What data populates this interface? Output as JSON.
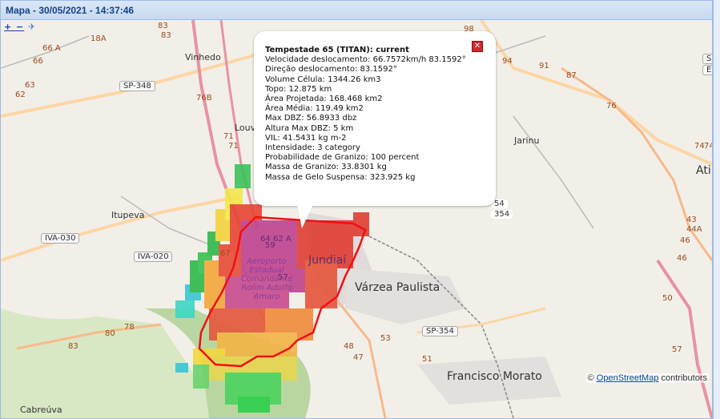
{
  "window": {
    "title": "Mapa - 30/05/2021 - 14:37:46"
  },
  "controls": {
    "zoom": "+ −",
    "layer_icon": "airplane-icon"
  },
  "popup": {
    "title": "Tempestade 65 (TITAN): current",
    "lines": [
      "Velocidade deslocamento: 66.7572km/h 83.1592°",
      "Direção deslocamento: 83.1592°",
      "Volume Célula: 1344.26 km3",
      "Topo: 12.875 km",
      "Área Projetada: 168.468 km2",
      "Área Média: 119.49 km2",
      "Max DBZ: 56.8933 dbz",
      "Altura Max DBZ: 5 km",
      "VIL: 41.5431 kg m-2",
      "Intensidade: 3 category",
      "Probabilidade de Granizo: 100 percent",
      "Massa de Granizo: 33.8301 kg",
      "Massa de Gelo Suspensa: 323.925 kg"
    ],
    "close_icon": "close-icon"
  },
  "attribution": {
    "prefix": "©",
    "link": "OpenStreetMap",
    "suffix": "contributors"
  },
  "places": {
    "vinhedo": "Vinhedo",
    "louveira": "Louv",
    "jarinu": "Jarinu",
    "itupeva": "Itupeva",
    "jundiai": "Jundiaí",
    "varzea": "Várzea Paulista",
    "francisco": "Francisco Morato",
    "cabreuva": "Cabreúva",
    "atibaia": "Ati",
    "airport": "Aeroporto Estadual Comandante Rolim Adolfo Amaro"
  },
  "shields": {
    "sp348": "SP-348",
    "iva030": "IVA-030",
    "iva020": "IVA-020",
    "sp354": "SP-354",
    "r54a": "54",
    "r54b": "354",
    "edge_top": "S",
    "edge_bottom": "E"
  },
  "road_numbers": [
    "66 A",
    "66",
    "18A",
    "83",
    "83",
    "98",
    "94",
    "91",
    "87",
    "63",
    "62",
    "76B",
    "71",
    "71",
    "74",
    "74",
    "80",
    "78",
    "83",
    "43",
    "44A",
    "46",
    "46",
    "50",
    "57",
    "57",
    "59",
    "64",
    "62 A",
    "48",
    "47",
    "53",
    "51",
    "67",
    "76"
  ]
}
